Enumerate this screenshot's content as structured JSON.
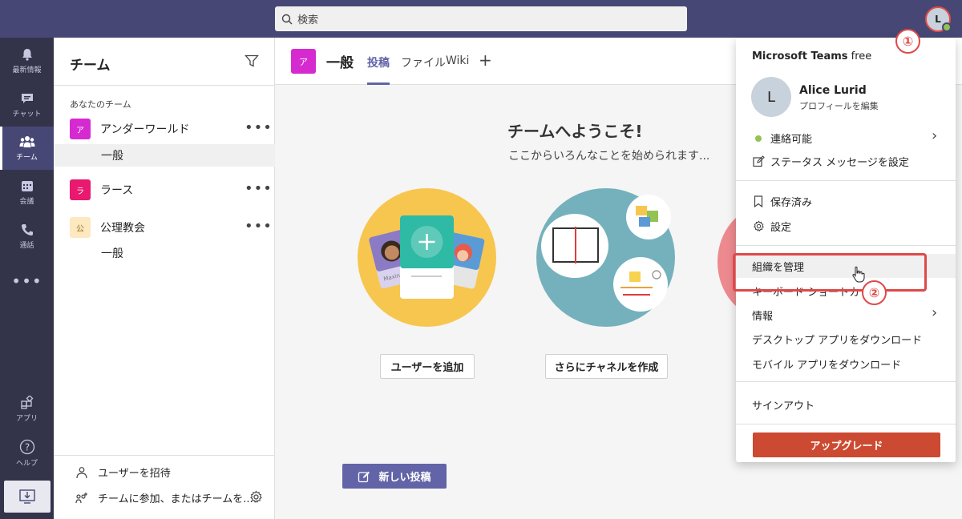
{
  "search": {
    "placeholder": "検索"
  },
  "user": {
    "initial": "L",
    "name": "Alice Lurid",
    "edit_profile": "プロフィールを編集"
  },
  "rail": {
    "items": [
      {
        "label": "最新情報",
        "icon": "bell-icon"
      },
      {
        "label": "チャット",
        "icon": "chat-icon"
      },
      {
        "label": "チーム",
        "icon": "teams-icon",
        "active": true
      },
      {
        "label": "会議",
        "icon": "calendar-icon"
      },
      {
        "label": "通話",
        "icon": "phone-icon"
      },
      {
        "label": "アプリ",
        "icon": "apps-icon"
      },
      {
        "label": "ヘルプ",
        "icon": "help-icon"
      }
    ]
  },
  "teams_panel": {
    "title": "チーム",
    "section": "あなたのチーム",
    "teams": [
      {
        "avatar": "ア",
        "name": "アンダーワールド",
        "color": "#d62ad1",
        "channel": "一般"
      },
      {
        "avatar": "ラ",
        "name": "ラース",
        "color": "#e8196f"
      },
      {
        "avatar": "公",
        "name": "公理教会",
        "color": "#fde8c0",
        "channel": "一般"
      }
    ],
    "invite": "ユーザーを招待",
    "join": "チームに参加、またはチームを..."
  },
  "channel_header": {
    "avatar": "ア",
    "title": "一般",
    "tabs": [
      "投稿",
      "ファイル",
      "Wiki"
    ]
  },
  "welcome": {
    "title": "チームへようこそ!",
    "subtitle": "ここからいろんなことを始められます...",
    "add_users": "ユーザーを追加",
    "create_channel": "さらにチャネルを作成",
    "card_name": "Maxine"
  },
  "new_post": "新しい投稿",
  "menu": {
    "app": "Microsoft Teams",
    "plan": "free",
    "status": "連絡可能",
    "status_message": "ステータス メッセージを設定",
    "saved": "保存済み",
    "settings": "設定",
    "manage_org": "組織を管理",
    "shortcuts": "キーボード ショートカット",
    "info": "情報",
    "desktop": "デスクトップ アプリをダウンロード",
    "mobile": "モバイル アプリをダウンロード",
    "signout": "サインアウト",
    "upgrade": "アップグレード"
  },
  "annotations": {
    "one": "①",
    "two": "②"
  },
  "colors": {
    "accent": "#6264a7",
    "topbar": "#464775",
    "rail": "#33344a",
    "annotation": "#e04848",
    "upgrade": "#cc4a31"
  }
}
